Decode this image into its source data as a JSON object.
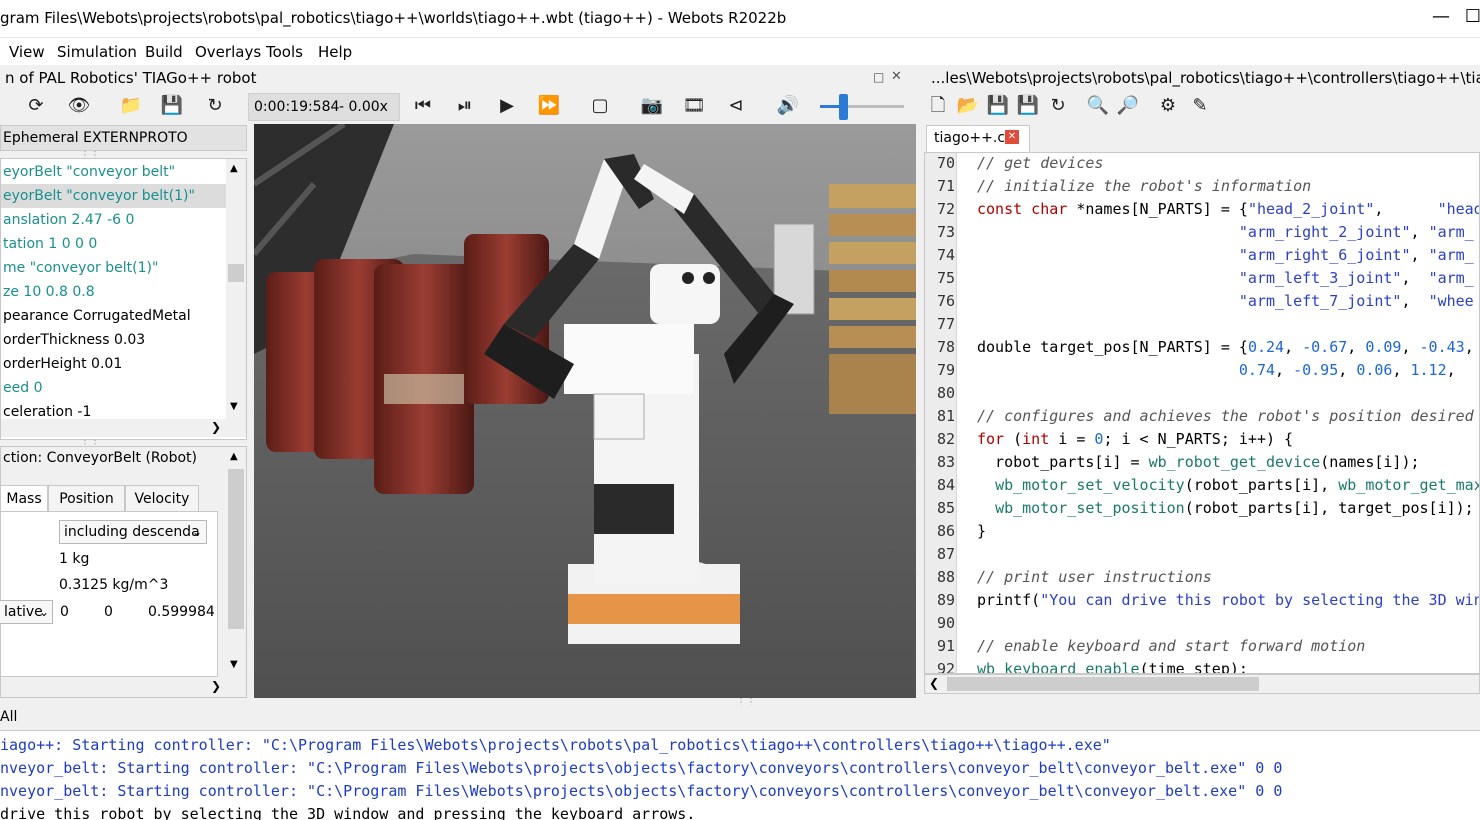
{
  "window": {
    "title": "gram Files\\Webots\\projects\\robots\\pal_robotics\\tiago++\\worlds\\tiago++.wbt (tiago++) - Webots R2022b",
    "minimize": "—",
    "maximize": "☐"
  },
  "menu": {
    "view": "View",
    "simulation": "Simulation",
    "build": "Build",
    "overlays": "Overlays",
    "tools": "Tools",
    "help": "Help"
  },
  "scene_panel": {
    "title": "n of PAL Robotics' TIAGo++ robot",
    "ephemeral_label": "Ephemeral EXTERNPROTO",
    "tree": [
      "eyorBelt \"conveyor belt\"",
      "eyorBelt \"conveyor belt(1)\"",
      "anslation 2.47 -6 0",
      "tation 1 0 0 0",
      "me \"conveyor belt(1)\"",
      "ze 10 0.8 0.8",
      "pearance CorrugatedMetal",
      "orderThickness 0.03",
      "orderHeight 0.01",
      "eed 0",
      "celeration -1"
    ]
  },
  "field_editor": {
    "title": "ction: ConveyorBelt (Robot)",
    "tabs": [
      "Mass",
      "Position",
      "Velocity"
    ],
    "mass_mode": "including descenda",
    "mass_value": "1 kg",
    "density_value": "0.3125 kg/m^3",
    "com_mode": "lative",
    "com_x": "0",
    "com_y": "0",
    "com_z": "0.599984"
  },
  "toolbar": {
    "sim_time": "0:00:19:584",
    "speed": "-  0.00x",
    "volume_fraction": 0.27
  },
  "editor_panel": {
    "path": "...les\\Webots\\projects\\robots\\pal_robotics\\tiago++\\controllers\\tiago++\\tiago++.c",
    "tab_name": "tiago++.c",
    "lines": [
      {
        "n": "70",
        "html": "<span class='cm'>// get devices</span>"
      },
      {
        "n": "71",
        "html": "<span class='cm'>// initialize the robot's information</span>"
      },
      {
        "n": "72",
        "html": "<span class='kw'>const char</span> *names[N_PARTS] = {<span class='str'>\"head_2_joint\"</span>,      <span class='str'>\"head_</span>"
      },
      {
        "n": "73",
        "html": "                             <span class='str'>\"arm_right_2_joint\"</span>, <span class='str'>\"arm_</span>"
      },
      {
        "n": "74",
        "html": "                             <span class='str'>\"arm_right_6_joint\"</span>, <span class='str'>\"arm_</span>"
      },
      {
        "n": "75",
        "html": "                             <span class='str'>\"arm_left_3_joint\"</span>,  <span class='str'>\"arm_</span>"
      },
      {
        "n": "76",
        "html": "                             <span class='str'>\"arm_left_7_joint\"</span>,  <span class='str'>\"whee</span>"
      },
      {
        "n": "77",
        "html": ""
      },
      {
        "n": "78",
        "html": "double target_pos[N_PARTS] = {<span class='num'>0.24</span>, <span class='num'>-0.67</span>, <span class='num'>0.09</span>, <span class='num'>-0.43</span>,"
      },
      {
        "n": "79",
        "html": "                             <span class='num'>0.74</span>, <span class='num'>-0.95</span>, <span class='num'>0.06</span>, <span class='num'>1.12</span>,"
      },
      {
        "n": "80",
        "html": ""
      },
      {
        "n": "81",
        "html": "<span class='cm'>// configures and achieves the robot's position desired</span>"
      },
      {
        "n": "82",
        "html": "<span class='kw'>for</span> (<span class='kw'>int</span> i = <span class='num'>0</span>; i &lt; N_PARTS; i++) {"
      },
      {
        "n": "83",
        "html": "  robot_parts[i] = <span class='fn'>wb_robot_get_device</span>(names[i]);"
      },
      {
        "n": "84",
        "html": "  <span class='fn'>wb_motor_set_velocity</span>(robot_parts[i], <span class='fn'>wb_motor_get_max</span>"
      },
      {
        "n": "85",
        "html": "  <span class='fn'>wb_motor_set_position</span>(robot_parts[i], target_pos[i]);"
      },
      {
        "n": "86",
        "html": "}"
      },
      {
        "n": "87",
        "html": ""
      },
      {
        "n": "88",
        "html": "<span class='cm'>// print user instructions</span>"
      },
      {
        "n": "89",
        "html": "printf(<span class='str'>\"You can drive this robot by selecting the 3D win</span>"
      },
      {
        "n": "90",
        "html": ""
      },
      {
        "n": "91",
        "html": "<span class='cm'>// enable keyboard and start forward motion</span>"
      },
      {
        "n": "92",
        "html": "<span class='fn'>wb_keyboard_enable</span>(time_step);"
      }
    ]
  },
  "console": {
    "filter": "All",
    "lines": [
      "iago++: Starting controller: \"C:\\Program Files\\Webots\\projects\\robots\\pal_robotics\\tiago++\\controllers\\tiago++\\tiago++.exe\"",
      "nveyor_belt: Starting controller: \"C:\\Program Files\\Webots\\projects\\objects\\factory\\conveyors\\controllers\\conveyor_belt\\conveyor_belt.exe\" 0 0",
      "nveyor_belt: Starting controller: \"C:\\Program Files\\Webots\\projects\\objects\\factory\\conveyors\\controllers\\conveyor_belt\\conveyor_belt.exe\" 0 0",
      "drive this robot by selecting the 3D window and pressing the keyboard arrows."
    ]
  }
}
